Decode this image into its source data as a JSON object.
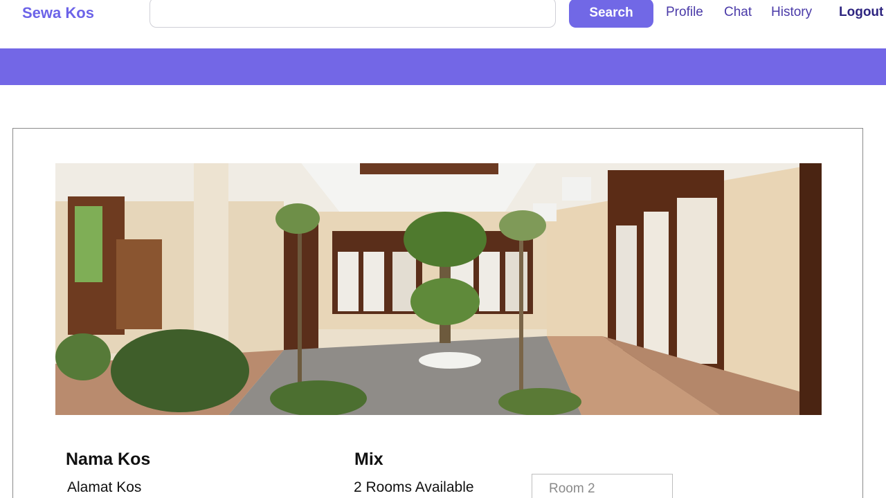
{
  "brand": "Sewa Kos",
  "search": {
    "placeholder": "",
    "button_label": "Search"
  },
  "nav": {
    "profile": "Profile",
    "chat": "Chat",
    "history": "History",
    "logout": "Logout"
  },
  "colors": {
    "accent": "#7367e6",
    "brand": "#6c63e8"
  },
  "listing": {
    "photo_icon": "kos-courtyard-photo",
    "name": "Nama Kos",
    "address": "Alamat Kos",
    "type": "Mix",
    "rooms_available": "2 Rooms Available",
    "room_select_placeholder": "Room 2"
  }
}
